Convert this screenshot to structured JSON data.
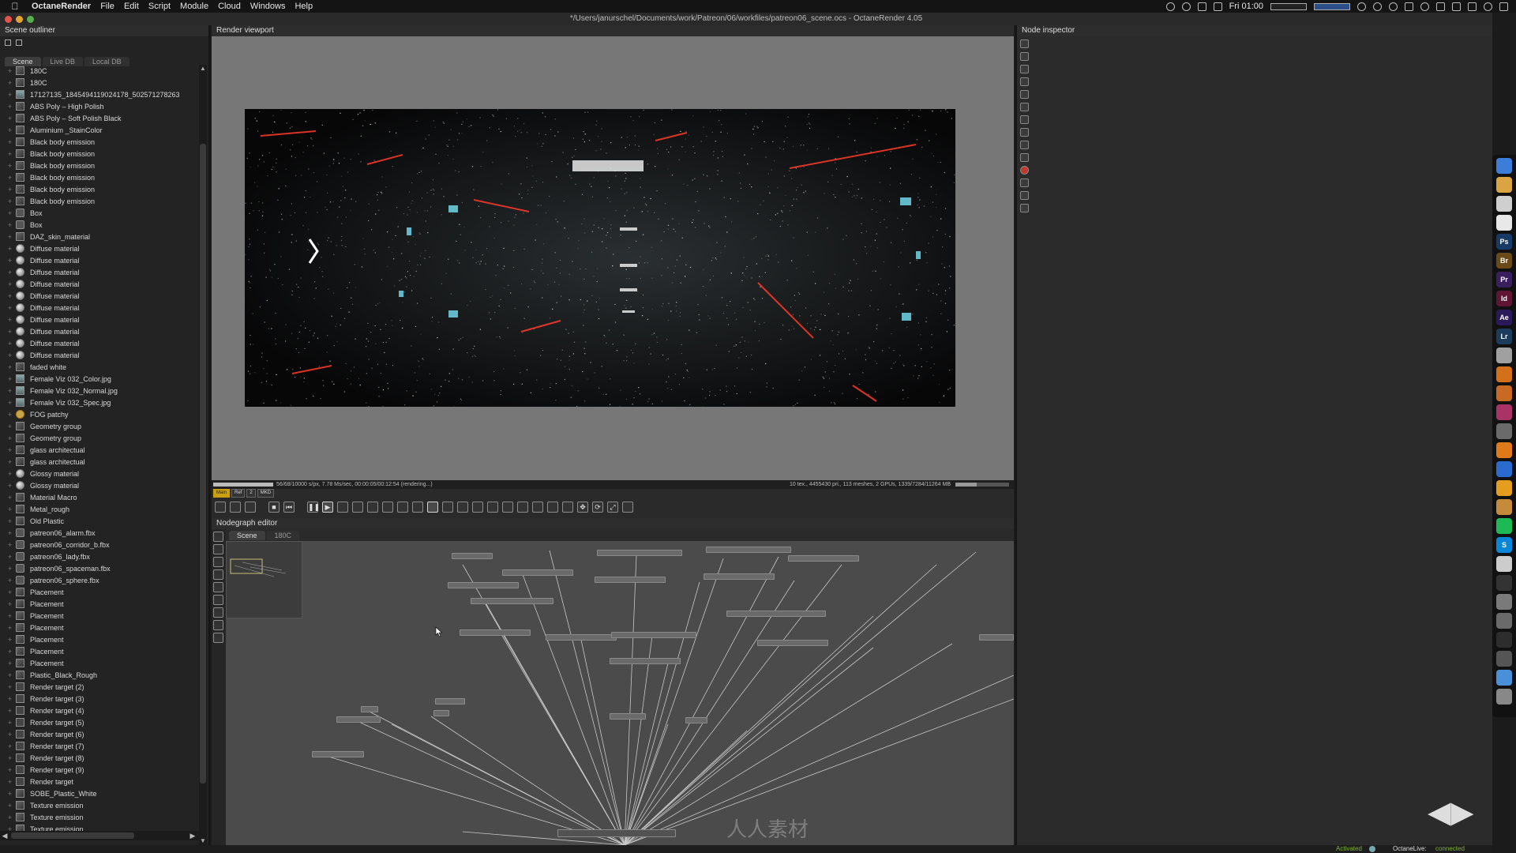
{
  "menubar": {
    "app": "OctaneRender",
    "items": [
      "File",
      "Edit",
      "Script",
      "Module",
      "Cloud",
      "Windows",
      "Help"
    ],
    "clock": "Fri 01:00"
  },
  "window_title": "*/Users/janurschel/Documents/work/Patreon/06/workfiles/patreon06_scene.ocs - OctaneRender 4.05",
  "outliner": {
    "title": "Scene outliner",
    "tabs": [
      "Scene",
      "Live DB",
      "Local DB"
    ],
    "items": [
      {
        "label": "180C",
        "icon": "node"
      },
      {
        "label": "180C",
        "icon": "node"
      },
      {
        "label": "17127135_1845494119024178_502571278263",
        "icon": "tex"
      },
      {
        "label": "ABS Poly – High Polish",
        "icon": "node"
      },
      {
        "label": "ABS Poly – Soft Polish Black",
        "icon": "node"
      },
      {
        "label": "Aluminium _StainColor",
        "icon": "node"
      },
      {
        "label": "Black body emission",
        "icon": "node"
      },
      {
        "label": "Black body emission",
        "icon": "node"
      },
      {
        "label": "Black body emission",
        "icon": "node"
      },
      {
        "label": "Black body emission",
        "icon": "node"
      },
      {
        "label": "Black body emission",
        "icon": "node"
      },
      {
        "label": "Black body emission",
        "icon": "node"
      },
      {
        "label": "Box",
        "icon": "geo"
      },
      {
        "label": "Box",
        "icon": "geo"
      },
      {
        "label": "DAZ_skin_material",
        "icon": "node"
      },
      {
        "label": "Diffuse material",
        "icon": "mat"
      },
      {
        "label": "Diffuse material",
        "icon": "mat"
      },
      {
        "label": "Diffuse material",
        "icon": "mat"
      },
      {
        "label": "Diffuse material",
        "icon": "mat"
      },
      {
        "label": "Diffuse material",
        "icon": "mat"
      },
      {
        "label": "Diffuse material",
        "icon": "mat"
      },
      {
        "label": "Diffuse material",
        "icon": "mat"
      },
      {
        "label": "Diffuse material",
        "icon": "mat"
      },
      {
        "label": "Diffuse material",
        "icon": "mat"
      },
      {
        "label": "Diffuse material",
        "icon": "mat"
      },
      {
        "label": "faded white",
        "icon": "node"
      },
      {
        "label": "Female Viz 032_Color.jpg",
        "icon": "tex"
      },
      {
        "label": "Female Viz 032_Normal.jpg",
        "icon": "tex"
      },
      {
        "label": "Female Viz 032_Spec.jpg",
        "icon": "tex"
      },
      {
        "label": "FOG patchy",
        "icon": "fog"
      },
      {
        "label": "Geometry group",
        "icon": "node"
      },
      {
        "label": "Geometry group",
        "icon": "node"
      },
      {
        "label": "glass architectual",
        "icon": "node"
      },
      {
        "label": "glass architectual",
        "icon": "node"
      },
      {
        "label": "Glossy material",
        "icon": "mat"
      },
      {
        "label": "Glossy material",
        "icon": "mat"
      },
      {
        "label": "Material Macro",
        "icon": "node"
      },
      {
        "label": "Metal_rough",
        "icon": "node"
      },
      {
        "label": "Old Plastic",
        "icon": "node"
      },
      {
        "label": "patreon06_alarm.fbx",
        "icon": "geo"
      },
      {
        "label": "patreon06_corridor_b.fbx",
        "icon": "geo"
      },
      {
        "label": "patreon06_lady.fbx",
        "icon": "geo"
      },
      {
        "label": "patreon06_spaceman.fbx",
        "icon": "geo"
      },
      {
        "label": "patreon06_sphere.fbx",
        "icon": "geo"
      },
      {
        "label": "Placement",
        "icon": "node"
      },
      {
        "label": "Placement",
        "icon": "node"
      },
      {
        "label": "Placement",
        "icon": "node"
      },
      {
        "label": "Placement",
        "icon": "node"
      },
      {
        "label": "Placement",
        "icon": "node"
      },
      {
        "label": "Placement",
        "icon": "node"
      },
      {
        "label": "Placement",
        "icon": "node"
      },
      {
        "label": "Plastic_Black_Rough",
        "icon": "node"
      },
      {
        "label": "Render target (2)",
        "icon": "out"
      },
      {
        "label": "Render target (3)",
        "icon": "out"
      },
      {
        "label": "Render target (4)",
        "icon": "out"
      },
      {
        "label": "Render target (5)",
        "icon": "out"
      },
      {
        "label": "Render target (6)",
        "icon": "out"
      },
      {
        "label": "Render target (7)",
        "icon": "out"
      },
      {
        "label": "Render target (8)",
        "icon": "out"
      },
      {
        "label": "Render target (9)",
        "icon": "out"
      },
      {
        "label": "Render target",
        "icon": "out"
      },
      {
        "label": "SOBE_Plastic_White",
        "icon": "node"
      },
      {
        "label": "Texture emission",
        "icon": "node"
      },
      {
        "label": "Texture emission",
        "icon": "node"
      },
      {
        "label": "Texture emission",
        "icon": "node"
      }
    ]
  },
  "viewport": {
    "title": "Render viewport",
    "status_left": "56/68/10000 s/px, 7.78 Ms/sec, 00:00:05/00:12:54 (rendering...)",
    "status_right": "10 tex., 4455430 pri., 113 meshes, 2 GPUs, 1339/7284/11264 MB",
    "modes": [
      "Main",
      "Ref",
      "2",
      "MKD"
    ]
  },
  "nodegraph": {
    "title": "Nodegraph editor",
    "tabs": [
      "Scene",
      "180C"
    ]
  },
  "inspector": {
    "title": "Node inspector"
  },
  "statusbar": {
    "activated": "Activated",
    "octanelive_label": "OctaneLive:",
    "octanelive_status": "connected"
  },
  "dock": {
    "apps": [
      {
        "label": "",
        "color": "#3b7dd8"
      },
      {
        "label": "",
        "color": "#d9a441"
      },
      {
        "label": "",
        "color": "#cfcfcf"
      },
      {
        "label": "",
        "color": "#e8e8e8"
      },
      {
        "label": "Ps",
        "color": "#173a66"
      },
      {
        "label": "Br",
        "color": "#6b4a1a"
      },
      {
        "label": "Pr",
        "color": "#3a1f5e"
      },
      {
        "label": "Id",
        "color": "#5e1633"
      },
      {
        "label": "Ae",
        "color": "#2b1a5a"
      },
      {
        "label": "Lr",
        "color": "#1d3c5c"
      },
      {
        "label": "",
        "color": "#a0a0a0"
      },
      {
        "label": "",
        "color": "#d46f1a"
      },
      {
        "label": "",
        "color": "#c96a22"
      },
      {
        "label": "",
        "color": "#a36"
      },
      {
        "label": "",
        "color": "#6a6a6a"
      },
      {
        "label": "",
        "color": "#e07a18"
      },
      {
        "label": "",
        "color": "#2b6acf"
      },
      {
        "label": "",
        "color": "#e49d1c"
      },
      {
        "label": "",
        "color": "#c58b3a"
      },
      {
        "label": "",
        "color": "#1db954"
      },
      {
        "label": "S",
        "color": "#0a86d8"
      },
      {
        "label": "",
        "color": "#cccccc"
      },
      {
        "label": "",
        "color": "#333"
      },
      {
        "label": "",
        "color": "#7a7a7a"
      },
      {
        "label": "",
        "color": "#6a6a6a"
      },
      {
        "label": "",
        "color": "#2d2d2d"
      },
      {
        "label": "",
        "color": "#555"
      },
      {
        "label": "",
        "color": "#4a90d9"
      },
      {
        "label": "",
        "color": "#888"
      }
    ]
  },
  "watermark": "人人素材"
}
